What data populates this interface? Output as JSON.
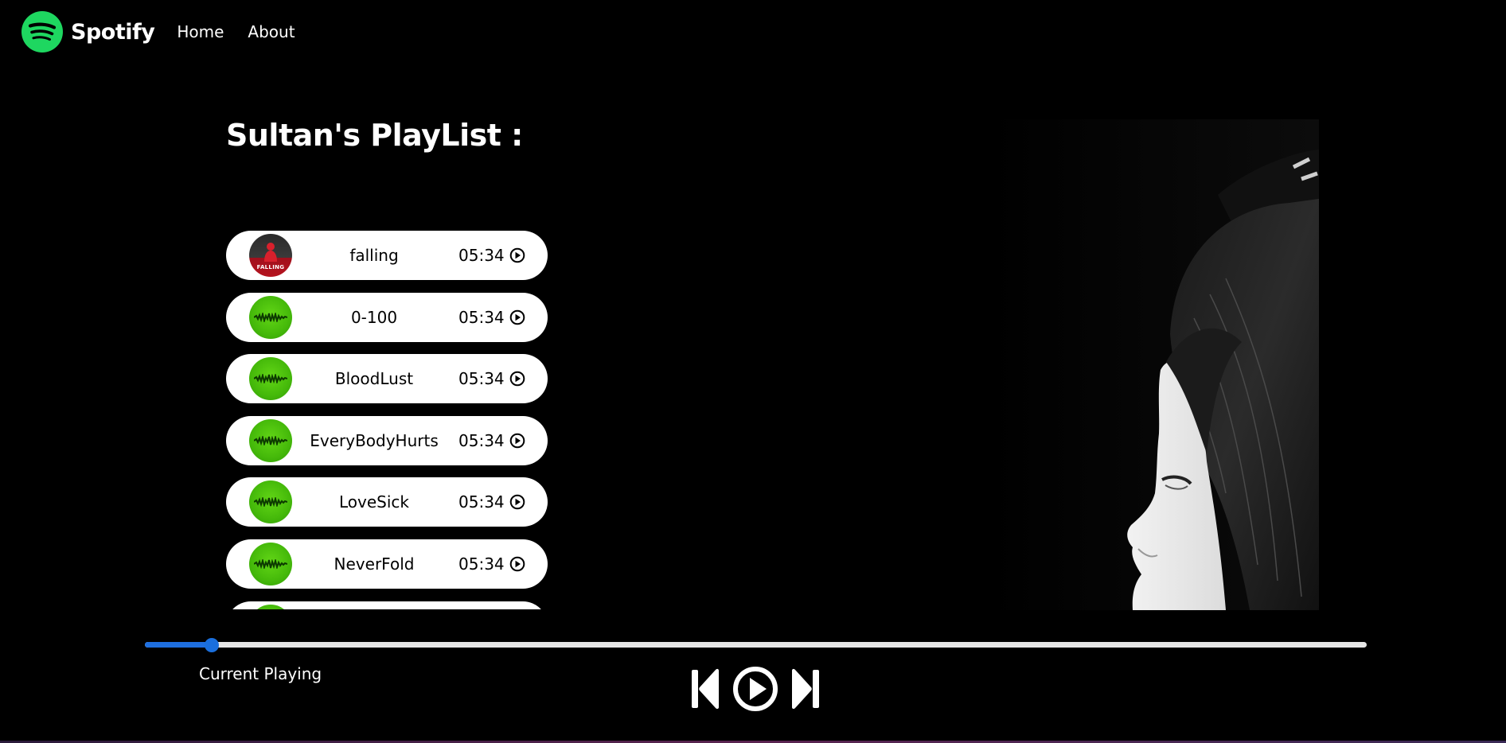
{
  "app": {
    "brand": "Spotify",
    "brand_color": "#1ed760"
  },
  "nav": {
    "links": [
      {
        "label": "Home"
      },
      {
        "label": "About"
      }
    ]
  },
  "playlist": {
    "title": "Sultan's PlayList :",
    "songs": [
      {
        "name": "falling",
        "duration": "05:34",
        "cover": "falling-cover",
        "cover_caption": "FALLING"
      },
      {
        "name": "0-100",
        "duration": "05:34",
        "cover": "no-name-cover"
      },
      {
        "name": "BloodLust",
        "duration": "05:34",
        "cover": "no-name-cover"
      },
      {
        "name": "EveryBodyHurts",
        "duration": "05:34",
        "cover": "no-name-cover"
      },
      {
        "name": "LoveSick",
        "duration": "05:34",
        "cover": "no-name-cover"
      },
      {
        "name": "NeverFold",
        "duration": "05:34",
        "cover": "no-name-cover"
      },
      {
        "name": "",
        "duration": "",
        "cover": "no-name-cover"
      }
    ]
  },
  "player": {
    "current_label": "Current Playing",
    "progress": 0.055,
    "progress_color": "#1e6fe0",
    "controls": [
      "previous-icon",
      "play-icon",
      "next-icon"
    ]
  }
}
